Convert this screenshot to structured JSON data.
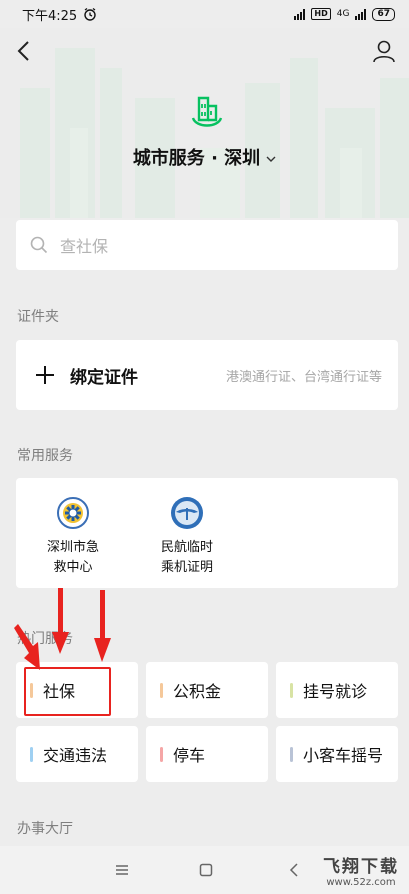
{
  "status_bar": {
    "time": "下午4:25",
    "network": "4G",
    "hd": "HD",
    "battery": "67"
  },
  "header": {
    "city_title": "城市服务 · 深圳",
    "back_icon": "back-arrow-icon",
    "user_icon": "user-icon"
  },
  "search": {
    "placeholder": "查社保"
  },
  "sections": {
    "certificates": "证件夹",
    "common": "常用服务",
    "hot": "热门服务",
    "hall": "办事大厅"
  },
  "certificate": {
    "label": "绑定证件",
    "hint": "港澳通行证、台湾通行证等"
  },
  "common_services": [
    {
      "line1": "深圳市急",
      "line2": "救中心",
      "icon": "emergency-center-icon"
    },
    {
      "line1": "民航临时",
      "line2": "乘机证明",
      "icon": "caac-icon"
    }
  ],
  "hot_services": [
    {
      "label": "社保",
      "color": "#f5c89a"
    },
    {
      "label": "公积金",
      "color": "#f5c89a"
    },
    {
      "label": "挂号就诊",
      "color": "#d8e3a4"
    },
    {
      "label": "交通违法",
      "color": "#9fd0f2"
    },
    {
      "label": "停车",
      "color": "#f5a6a6"
    },
    {
      "label": "小客车摇号",
      "color": "#b9c3d6"
    }
  ],
  "accent": "#07c160",
  "watermark": {
    "brand": "飞翔下载",
    "url": "www.52z.com"
  }
}
